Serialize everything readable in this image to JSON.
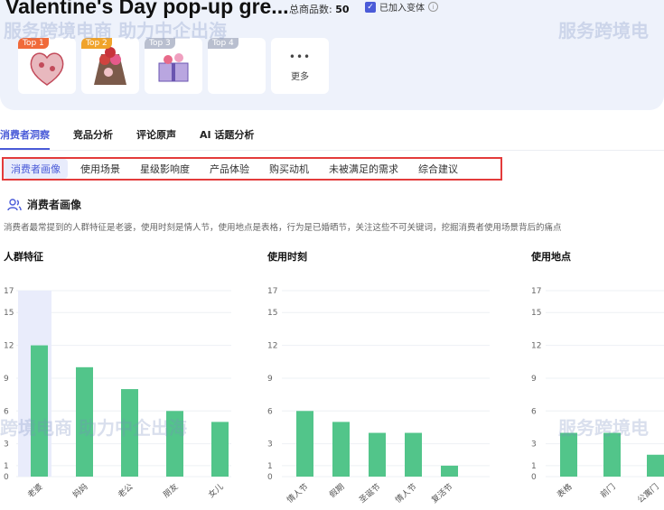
{
  "header": {
    "title": "Valentine's Day pop-up gre...",
    "total_label": "总商品数:",
    "total_value": "50",
    "variant_label": "已加入变体",
    "more_label": "更多"
  },
  "thumbnails": [
    {
      "badge": "Top 1"
    },
    {
      "badge": "Top 2"
    },
    {
      "badge": "Top 3"
    },
    {
      "badge": "Top 4"
    }
  ],
  "main_tabs": [
    "消费者洞察",
    "竞品分析",
    "评论原声",
    "AI 话题分析"
  ],
  "sub_tabs": [
    "消费者画像",
    "使用场景",
    "星级影响度",
    "产品体验",
    "购买动机",
    "未被满足的需求",
    "综合建议"
  ],
  "section": {
    "title": "消费者画像",
    "description": "消费者最常提到的人群特征是老婆，使用时刻是情人节，使用地点是表格，行为是已婚晒节，关注这些不可关键词，挖掘消费者使用场景背后的痛点"
  },
  "watermarks": [
    "服务跨境电商 助力中企出海",
    "服务跨境电",
    "跨境电商 助力中企出海",
    "服务跨境电"
  ],
  "colors": {
    "bar": "#52c58a",
    "accent": "#4a5bd8",
    "highlight_box": "#e33b3b"
  },
  "chart_data": [
    {
      "type": "bar",
      "title": "人群特征",
      "categories": [
        "老婆",
        "妈妈",
        "老公",
        "朋友",
        "女儿"
      ],
      "values": [
        12,
        10,
        8,
        6,
        5
      ],
      "yticks": [
        0,
        1,
        3,
        6,
        9,
        12,
        15,
        17
      ],
      "ylim": [
        0,
        17
      ],
      "highlight": "老婆"
    },
    {
      "type": "bar",
      "title": "使用时刻",
      "categories": [
        "情人节",
        "假期",
        "圣诞节",
        "情人节",
        "复活节"
      ],
      "values": [
        6,
        5,
        4,
        4,
        1
      ],
      "yticks": [
        0,
        1,
        3,
        6,
        9,
        12,
        15,
        17
      ],
      "ylim": [
        0,
        17
      ]
    },
    {
      "type": "bar",
      "title": "使用地点",
      "categories": [
        "表格",
        "前门",
        "公寓门"
      ],
      "values": [
        4,
        4,
        2
      ],
      "yticks": [
        0,
        1,
        3,
        6,
        9,
        12,
        15,
        17
      ],
      "ylim": [
        0,
        17
      ]
    }
  ]
}
